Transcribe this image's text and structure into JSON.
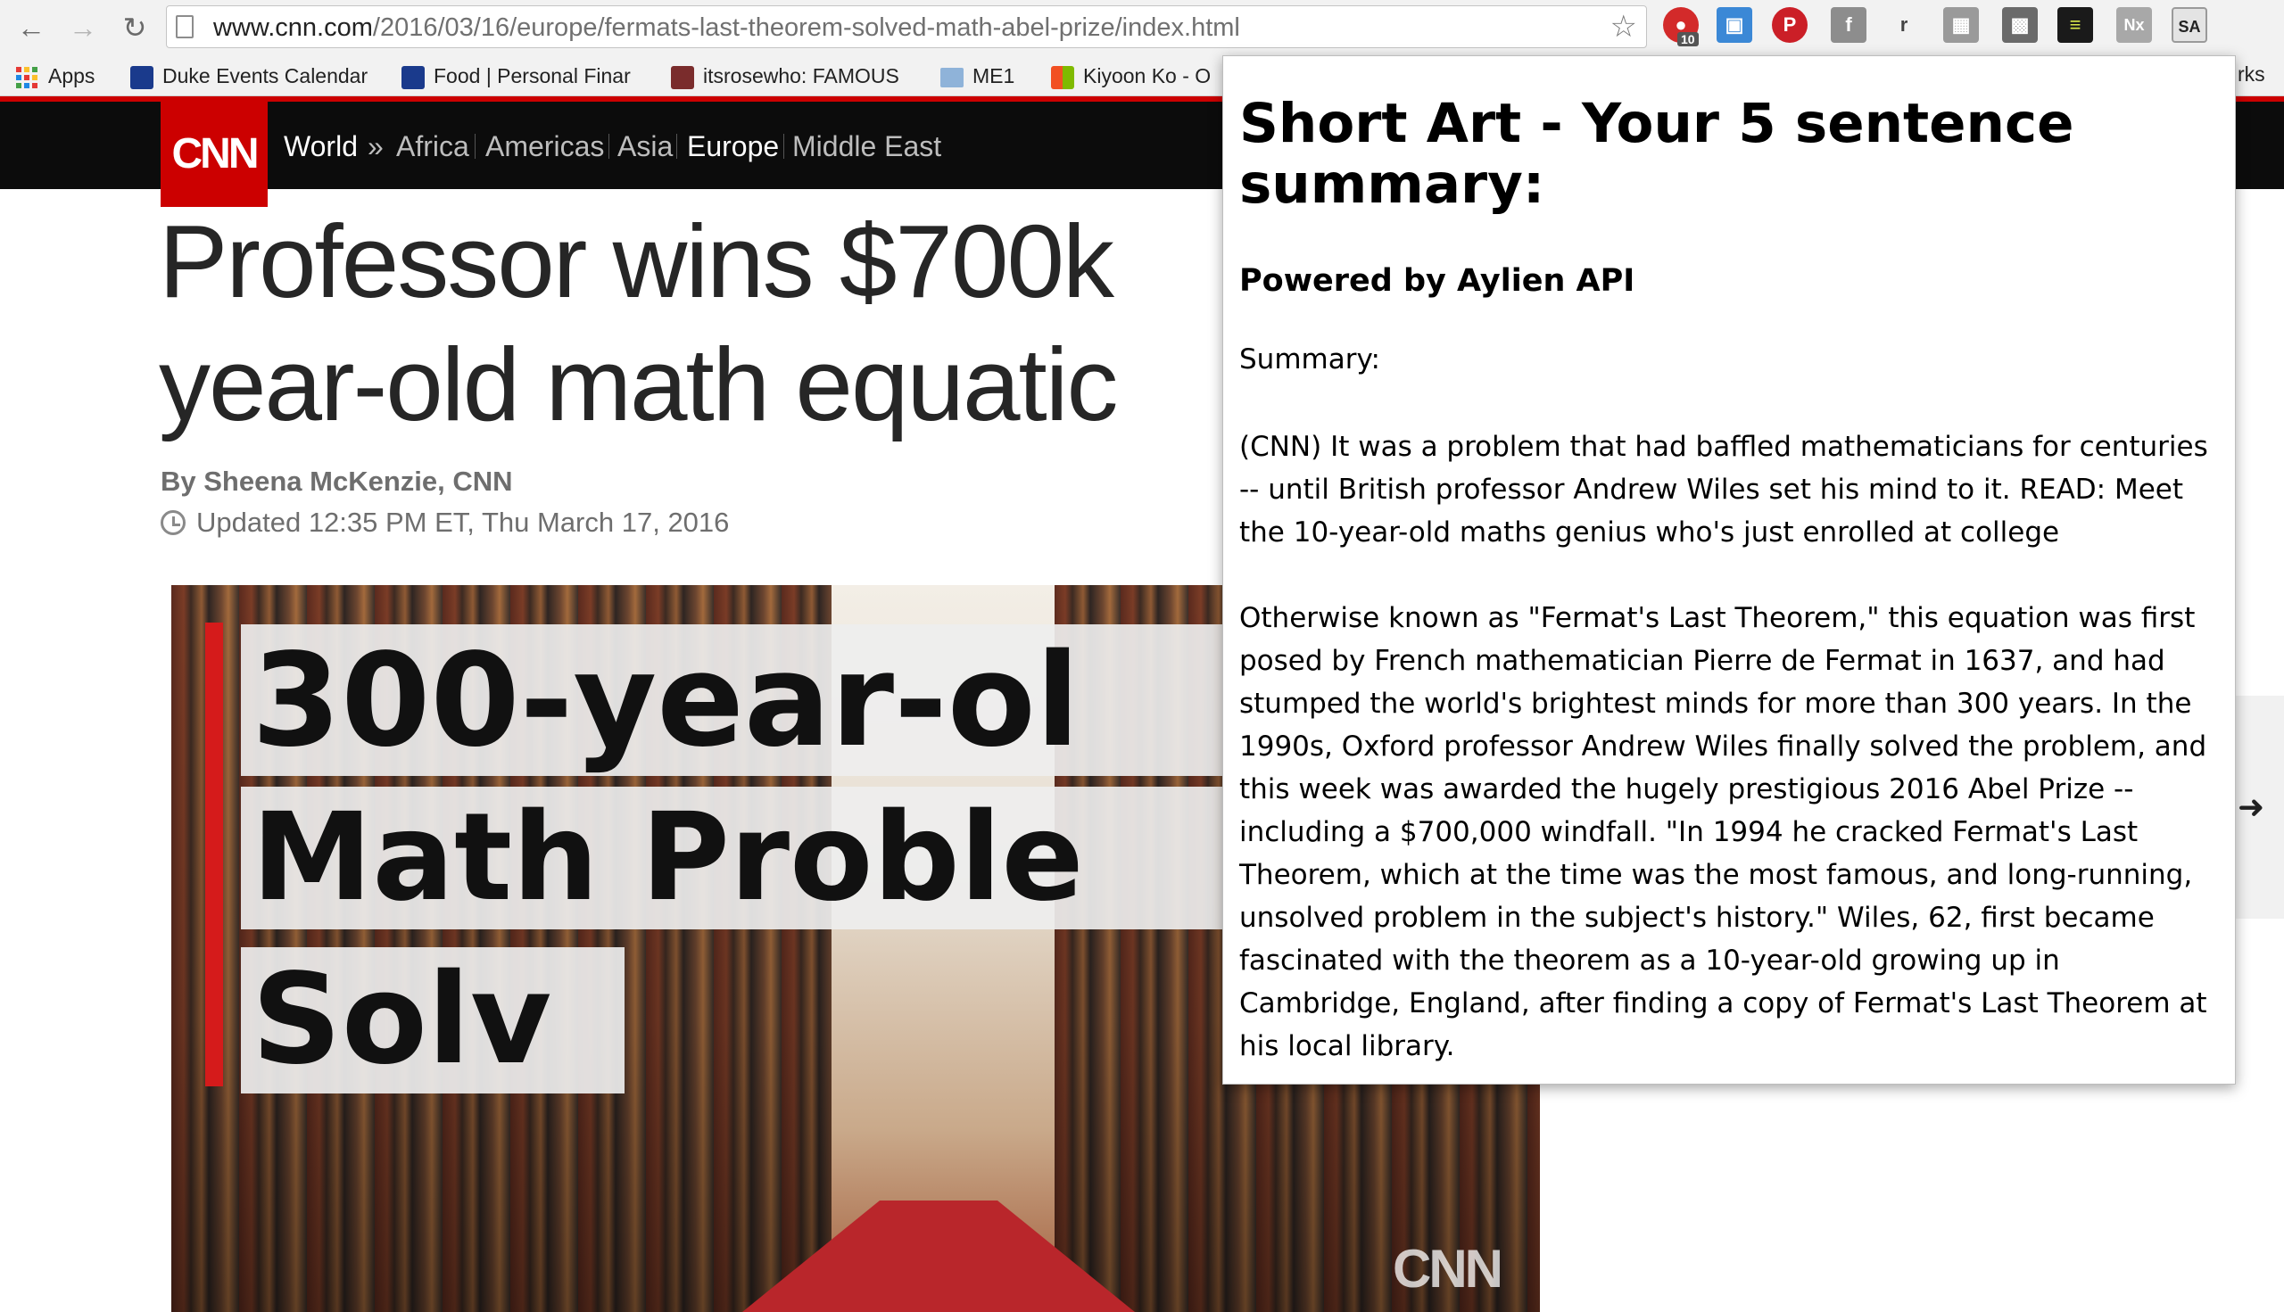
{
  "browser": {
    "url_domain": "www.cnn.com",
    "url_path": "/2016/03/16/europe/fermats-last-theorem-solved-math-abel-prize/index.html",
    "extension_badge": "10",
    "bookmarks": [
      {
        "label": "Apps"
      },
      {
        "label": "Duke Events Calendar"
      },
      {
        "label": "Food | Personal Finar"
      },
      {
        "label": "itsrosewho: FAMOUS"
      },
      {
        "label": "ME1"
      },
      {
        "label": "Kiyoon Ko - O"
      }
    ],
    "bookmarks_overflow_tail": "rks",
    "colors": {
      "accent_red": "#cc0000",
      "chrome_bg": "#f2f2f2"
    }
  },
  "cnn": {
    "logo": "CNN",
    "breadcrumb": {
      "section": "World",
      "separator": "»",
      "items": [
        "Africa",
        "Americas",
        "Asia",
        "Europe",
        "Middle East"
      ],
      "active": "Europe"
    },
    "headline_line1": "Professor wins $700k",
    "headline_line2": "year-old math equatic",
    "byline": "By Sheena McKenzie, CNN",
    "updated": "Updated 12:35 PM ET, Thu March 17, 2016",
    "video": {
      "line1": "300-year-ol",
      "line2": "Math Proble",
      "line3": "Solv",
      "watermark": "CNN"
    }
  },
  "popup": {
    "title": "Short Art - Your 5 sentence summary:",
    "subtitle": "Powered by Aylien API",
    "label": "Summary:",
    "paragraph1": "(CNN) It was a problem that had baffled mathematicians for centuries -- until British professor Andrew Wiles set his mind to it. READ: Meet the 10-year-old maths genius who's just enrolled at college",
    "paragraph2": "Otherwise known as \"Fermat's Last Theorem,\" this equation was first posed by French mathematician Pierre de Fermat in 1637, and had stumped the world's brightest minds for more than 300 years. In the 1990s, Oxford professor Andrew Wiles finally solved the problem, and this week was awarded the hugely prestigious 2016 Abel Prize -- including a $700,000 windfall. \"In 1994 he cracked Fermat's Last Theorem, which at the time was the most famous, and long-running, unsolved problem in the subject's history.\" Wiles, 62, first became fascinated with the theorem as a 10-year-old growing up in Cambridge, England, after finding a copy of Fermat's Last Theorem at his local library."
  }
}
